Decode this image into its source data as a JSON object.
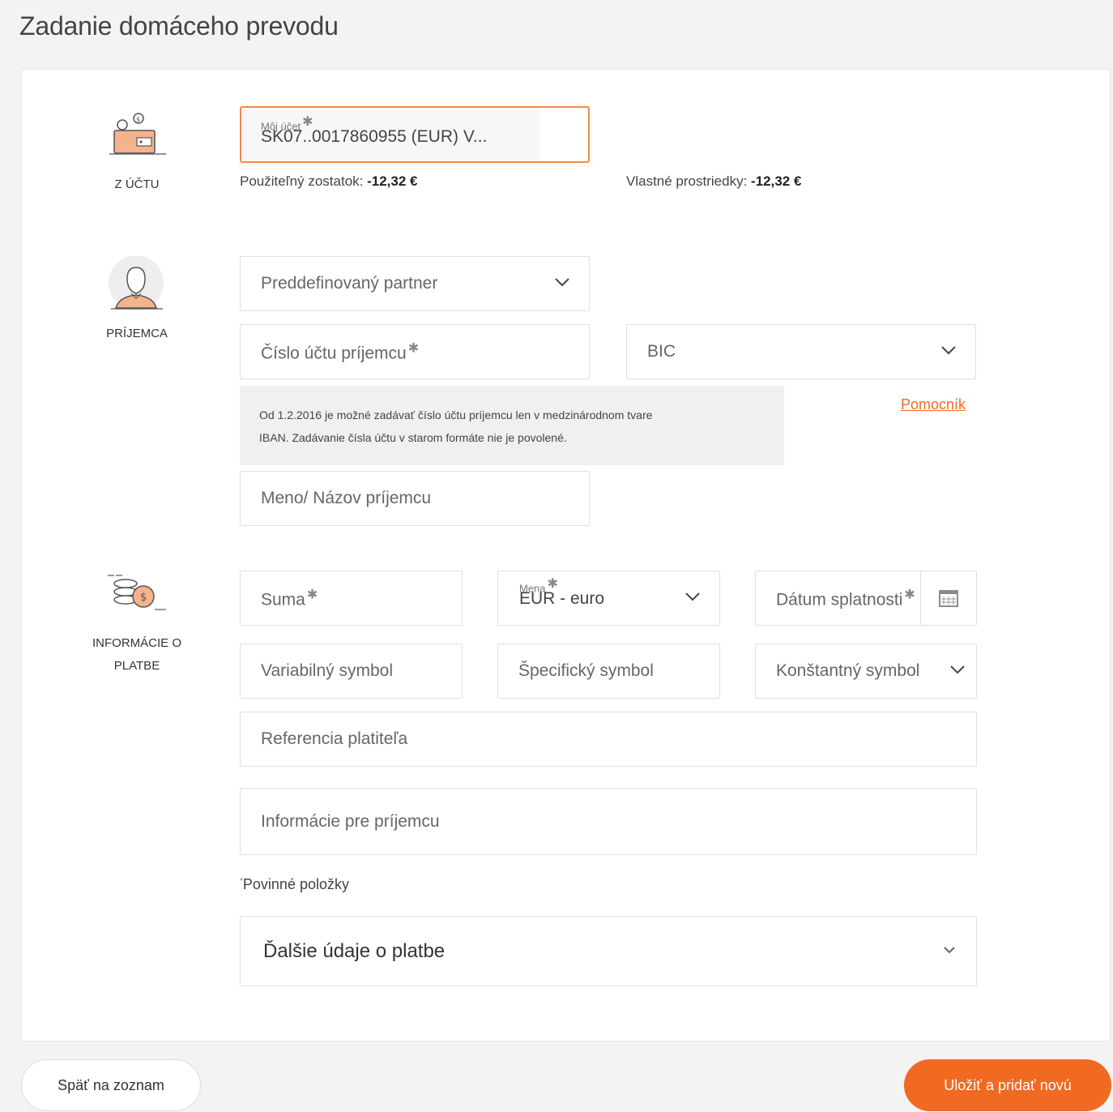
{
  "page": {
    "title": "Zadanie domáceho prevodu"
  },
  "colors": {
    "accent": "#f06a22",
    "accent_border": "#f08a4b",
    "info_bg": "#f0f0f0"
  },
  "from_account": {
    "label": "Z ÚČTU",
    "icon": "wallet-icon",
    "field_label": "Môj účet",
    "value": "SK07..0017860955 (EUR) V...",
    "available_label": "Použiteľný zostatok:",
    "available_value": "-12,32 €",
    "own_label": "Vlastné prostriedky:",
    "own_value": "-12,32 €"
  },
  "recipient": {
    "label": "PRÍJEMCA",
    "icon": "person-icon",
    "partner_placeholder": "Preddefinovaný partner",
    "account_placeholder": "Číslo účtu príjemcu",
    "bic_placeholder": "BIC",
    "info_line1": "Od 1.2.2016 je možné zadávať číslo účtu príjemcu len v medzinárodnom tvare",
    "info_line2": "IBAN. Zadávanie čísla účtu v starom formáte nie je povolené.",
    "helper_link": "Pomocník",
    "name_placeholder": "Meno/ Názov príjemcu"
  },
  "payment": {
    "label_line1": "INFORMÁCIE O",
    "label_line2": "PLATBE",
    "icon": "coins-icon",
    "amount_placeholder": "Suma",
    "currency_label": "Mena",
    "currency_value": "EUR - euro",
    "due_date_placeholder": "Dátum splatnosti",
    "variable_symbol": "Variabilný symbol",
    "specific_symbol": "Špecifický symbol",
    "constant_symbol": "Konštantný symbol",
    "payer_reference": "Referencia platiteľa",
    "recipient_info": "Informácie pre príjemcu"
  },
  "required_note": "Povinné položky",
  "more_details": "Ďalšie údaje o platbe",
  "buttons": {
    "back": "Späť na zoznam",
    "save_add": "Uložiť a pridať novú"
  }
}
